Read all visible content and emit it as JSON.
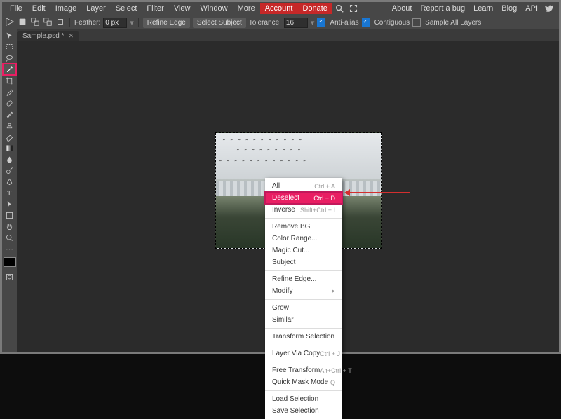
{
  "menu": {
    "items": [
      "File",
      "Edit",
      "Image",
      "Layer",
      "Select",
      "Filter",
      "View",
      "Window",
      "More"
    ],
    "account": "Account",
    "donate": "Donate",
    "right": [
      "About",
      "Report a bug",
      "Learn",
      "Blog",
      "API"
    ]
  },
  "opt": {
    "feather_label": "Feather:",
    "feather_val": "0 px",
    "refine": "Refine Edge",
    "subject": "Select Subject",
    "tol_label": "Tolerance:",
    "tol_val": "16",
    "aa": "Anti-alias",
    "contig": "Contiguous",
    "alllayers": "Sample All Layers"
  },
  "tab": {
    "name": "Sample.psd *"
  },
  "ctx": [
    {
      "t": "All",
      "s": "Ctrl + A"
    },
    {
      "t": "Deselect",
      "s": "Ctrl + D",
      "hl": true
    },
    {
      "t": "Inverse",
      "s": "Shift+Ctrl + I"
    },
    {
      "hr": true
    },
    {
      "t": "Remove BG"
    },
    {
      "t": "Color Range..."
    },
    {
      "t": "Magic Cut..."
    },
    {
      "t": "Subject"
    },
    {
      "hr": true
    },
    {
      "t": "Refine Edge..."
    },
    {
      "t": "Modify",
      "sub": true
    },
    {
      "hr": true
    },
    {
      "t": "Grow"
    },
    {
      "t": "Similar"
    },
    {
      "hr": true
    },
    {
      "t": "Transform Selection"
    },
    {
      "hr": true
    },
    {
      "t": "Layer Via Copy",
      "s": "Ctrl + J"
    },
    {
      "hr": true
    },
    {
      "t": "Free Transform",
      "s": "Alt+Ctrl + T"
    },
    {
      "t": "Quick Mask Mode",
      "s": "Q"
    },
    {
      "hr": true
    },
    {
      "t": "Load Selection"
    },
    {
      "t": "Save Selection"
    }
  ],
  "tools": [
    "move",
    "rect-select",
    "lasso",
    "wand",
    "crop",
    "eyedrop",
    "heal",
    "brush",
    "stamp",
    "eraser",
    "grad",
    "blur",
    "dodge",
    "pen",
    "text",
    "path",
    "shape",
    "hand",
    "zoom",
    "more1",
    "more2"
  ]
}
